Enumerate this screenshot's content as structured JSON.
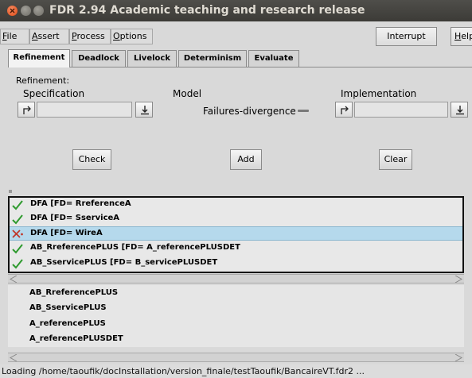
{
  "window": {
    "title": "FDR 2.94 Academic teaching and research release"
  },
  "menu": {
    "file": "File",
    "file_u": "F",
    "file_rest": "ile",
    "assert": "Assert",
    "assert_u": "A",
    "assert_rest": "ssert",
    "process": "Process",
    "process_u": "P",
    "process_rest": "rocess",
    "options": "Options",
    "options_u": "O",
    "options_rest": "ptions",
    "interrupt": "Interrupt",
    "help": "Help",
    "help_u": "H",
    "help_rest": "elp"
  },
  "tabs": [
    {
      "label": "Refinement",
      "active": true
    },
    {
      "label": "Deadlock",
      "active": false
    },
    {
      "label": "Livelock",
      "active": false
    },
    {
      "label": "Determinism",
      "active": false
    },
    {
      "label": "Evaluate",
      "active": false
    }
  ],
  "refinement": {
    "heading": "Refinement:",
    "specification_label": "Specification",
    "model_label": "Model",
    "model_value": "Failures-divergence",
    "implementation_label": "Implementation",
    "check_button": "Check",
    "add_button": "Add",
    "clear_button": "Clear"
  },
  "assertions": [
    {
      "text": "DFA [FD= RreferenceA",
      "status": "pass",
      "selected": false
    },
    {
      "text": "DFA [FD= SserviceA",
      "status": "pass",
      "selected": false
    },
    {
      "text": "DFA [FD= WireA",
      "status": "fail",
      "selected": true
    },
    {
      "text": "AB_RreferencePLUS [FD= A_referencePLUSDET",
      "status": "pass",
      "selected": false
    },
    {
      "text": "AB_SservicePLUS [FD= B_servicePLUSDET",
      "status": "pass",
      "selected": false
    }
  ],
  "processes": [
    "AB_RreferencePLUS",
    "AB_SservicePLUS",
    "A_referencePLUS",
    "A_referencePLUSDET"
  ],
  "status": {
    "text": "Loading /home/taoufik/docInstallation/version_finale/testTaoufik/BancaireVT.fdr2 ..."
  },
  "colors": {
    "titlebar": "#3c3b37",
    "selection": "#b5d9ec",
    "pass_check": "#2e9a2e",
    "fail_cross": "#c0392b"
  }
}
